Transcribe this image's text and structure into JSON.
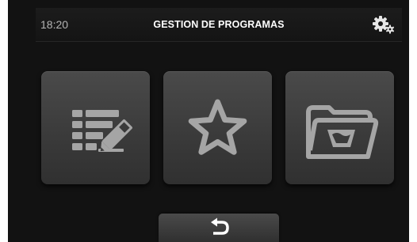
{
  "header": {
    "time": "18:20",
    "title": "GESTION DE PROGRAMAS",
    "settings_icon": "settings-gears-icon"
  },
  "tiles": [
    {
      "icon": "edit-list-icon"
    },
    {
      "icon": "star-favorites-icon"
    },
    {
      "icon": "folder-basket-icon"
    }
  ],
  "footer": {
    "back_icon": "back-return-icon"
  },
  "colors": {
    "background": "#121212",
    "tile": "#3b3b3b",
    "icon": "#a5a5a5",
    "text": "#ffffff",
    "time_text": "#b4b4b4"
  }
}
